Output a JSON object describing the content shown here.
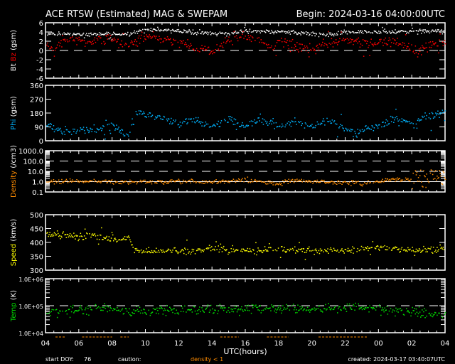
{
  "header": {
    "title": "ACE RTSW (Estimated) MAG & SWEPAM",
    "begin": "Begin: 2024-03-16 04:00:00UTC"
  },
  "footer": {
    "start_doy_label": "start DOY:",
    "start_doy": "76",
    "caution_label": "caution:",
    "caution_text": "density < 1",
    "created": "created: 2024-03-17 03:40:07UTC"
  },
  "colors": {
    "bt": "#ffffff",
    "bz": "#ff0000",
    "phi": "#00b4ff",
    "density": "#ff8c00",
    "speed": "#ffff00",
    "temp": "#00e000",
    "caution": "#ff8c00"
  },
  "chart_data": {
    "type": "scatter",
    "xlabel": "UTC(hours)",
    "x_range_hours": [
      0,
      24
    ],
    "x_tick_labels": [
      "04",
      "06",
      "08",
      "10",
      "12",
      "14",
      "16",
      "18",
      "20",
      "22",
      "00",
      "02",
      "04"
    ],
    "panels": [
      {
        "id": "mag",
        "ylabel_parts": [
          "Bt",
          "Bz",
          "(gsm)"
        ],
        "scale": "linear",
        "ylim": [
          -6,
          6
        ],
        "ticks": [
          6,
          4,
          2,
          0,
          -2,
          -4,
          -6
        ],
        "tick_labels": [
          "6",
          "4",
          "2",
          "0",
          "-2",
          "-4",
          "-6"
        ],
        "ref_lines": [
          0
        ],
        "series": [
          {
            "name": "Bt",
            "color": "bt",
            "trend": [
              [
                0,
                3.8
              ],
              [
                2,
                3.6
              ],
              [
                4,
                3.7
              ],
              [
                5,
                3.4
              ],
              [
                5.6,
                4.6
              ],
              [
                7,
                4.6
              ],
              [
                8,
                4.3
              ],
              [
                9,
                3.9
              ],
              [
                10,
                3.7
              ],
              [
                11,
                4.0
              ],
              [
                12,
                4.2
              ],
              [
                13,
                4.3
              ],
              [
                14,
                4.2
              ],
              [
                15,
                4.0
              ],
              [
                16,
                3.8
              ],
              [
                17,
                3.5
              ],
              [
                18,
                4.0
              ],
              [
                19,
                4.2
              ],
              [
                20,
                4.0
              ],
              [
                22,
                4.3
              ],
              [
                24,
                4.2
              ]
            ],
            "spread": 0.3
          },
          {
            "name": "Bz",
            "color": "bz",
            "trend": [
              [
                0,
                2.0
              ],
              [
                0.5,
                0.2
              ],
              [
                1,
                2.3
              ],
              [
                2,
                2.2
              ],
              [
                3,
                2.2
              ],
              [
                4,
                2.6
              ],
              [
                4.5,
                1.6
              ],
              [
                5,
                1.3
              ],
              [
                6,
                3.0
              ],
              [
                7,
                2.5
              ],
              [
                8,
                2.0
              ],
              [
                9,
                0.6
              ],
              [
                10,
                0.1
              ],
              [
                11,
                2.4
              ],
              [
                12,
                3.1
              ],
              [
                13,
                1.8
              ],
              [
                13.6,
                0.5
              ],
              [
                14,
                2.2
              ],
              [
                15,
                1.0
              ],
              [
                16,
                0.3
              ],
              [
                17,
                1.6
              ],
              [
                18,
                2.6
              ],
              [
                19,
                1.8
              ],
              [
                20,
                1.6
              ],
              [
                21,
                2.2
              ],
              [
                22,
                0.4
              ],
              [
                22.5,
                -0.4
              ],
              [
                23,
                1.2
              ],
              [
                24,
                2.0
              ]
            ],
            "spread": 0.7
          }
        ]
      },
      {
        "id": "phi",
        "ylabel_parts": [
          "Phi",
          "(gsm)"
        ],
        "scale": "linear",
        "ylim": [
          0,
          360
        ],
        "ticks": [
          360,
          270,
          180,
          90,
          0
        ],
        "tick_labels": [
          "360",
          "270",
          "180",
          "90",
          "0"
        ],
        "ref_lines": [],
        "series": [
          {
            "name": "Phi",
            "color": "phi",
            "trend": [
              [
                0,
                120
              ],
              [
                1,
                60
              ],
              [
                2,
                70
              ],
              [
                3,
                80
              ],
              [
                4,
                110
              ],
              [
                4.6,
                50
              ],
              [
                5,
                40
              ],
              [
                5.4,
                190
              ],
              [
                6,
                175
              ],
              [
                7,
                150
              ],
              [
                8,
                110
              ],
              [
                9,
                140
              ],
              [
                10,
                90
              ],
              [
                11,
                150
              ],
              [
                12,
                100
              ],
              [
                13,
                140
              ],
              [
                14,
                100
              ],
              [
                15,
                125
              ],
              [
                16,
                90
              ],
              [
                17,
                130
              ],
              [
                18,
                80
              ],
              [
                18.6,
                45
              ],
              [
                19,
                70
              ],
              [
                20,
                100
              ],
              [
                21,
                150
              ],
              [
                22,
                120
              ],
              [
                23,
                165
              ],
              [
                24,
                195
              ]
            ],
            "spread": 18
          }
        ]
      },
      {
        "id": "density",
        "ylabel_parts": [
          "Density",
          "(/cm3)"
        ],
        "scale": "log",
        "ylim": [
          0.1,
          1000
        ],
        "ticks": [
          1000,
          100,
          10,
          1,
          0.1
        ],
        "tick_labels": [
          "1000.0",
          "100.0",
          "10.0",
          "1.0",
          "0.1"
        ],
        "ref_lines": [
          100,
          10,
          1
        ],
        "series": [
          {
            "name": "Density",
            "color": "density",
            "trend": [
              [
                0,
                1.2
              ],
              [
                4,
                1.1
              ],
              [
                6,
                1.0
              ],
              [
                8,
                1.1
              ],
              [
                10,
                1.0
              ],
              [
                12,
                1.6
              ],
              [
                13,
                1.0
              ],
              [
                14,
                0.8
              ],
              [
                15,
                1.5
              ],
              [
                16,
                1.2
              ],
              [
                18,
                0.9
              ],
              [
                19,
                0.7
              ],
              [
                20,
                1.3
              ],
              [
                21,
                1.8
              ],
              [
                22,
                2.2
              ],
              [
                23,
                3
              ],
              [
                24,
                5
              ]
            ],
            "spread": 0.15
          }
        ]
      },
      {
        "id": "speed",
        "ylabel_parts": [
          "Speed",
          "(km/s)"
        ],
        "scale": "linear",
        "ylim": [
          300,
          500
        ],
        "ticks": [
          500,
          450,
          400,
          350,
          300
        ],
        "tick_labels": [
          "500",
          "450",
          "400",
          "350",
          "300"
        ],
        "ref_lines": [],
        "series": [
          {
            "name": "Speed",
            "color": "speed",
            "trend": [
              [
                0,
                430
              ],
              [
                2,
                425
              ],
              [
                3,
                430
              ],
              [
                4,
                410
              ],
              [
                5,
                415
              ],
              [
                5.3,
                370
              ],
              [
                8,
                372
              ],
              [
                10,
                378
              ],
              [
                12,
                372
              ],
              [
                14,
                378
              ],
              [
                16,
                372
              ],
              [
                18,
                374
              ],
              [
                20,
                385
              ],
              [
                22,
                372
              ],
              [
                24,
                380
              ]
            ],
            "spread": 8
          }
        ]
      },
      {
        "id": "temp",
        "ylabel_parts": [
          "Temp",
          "(K)"
        ],
        "scale": "log",
        "ylim": [
          10000,
          1000000
        ],
        "ticks": [
          1000000,
          100000,
          10000
        ],
        "tick_labels": [
          "1.0E+06",
          "1.0E+05",
          "1.0E+04"
        ],
        "ref_lines": [
          100000
        ],
        "series": [
          {
            "name": "Temp",
            "color": "temp",
            "trend": [
              [
                0,
                60000
              ],
              [
                2,
                65000
              ],
              [
                3,
                80000
              ],
              [
                4,
                75000
              ],
              [
                5,
                60000
              ],
              [
                6,
                65000
              ],
              [
                8,
                70000
              ],
              [
                10,
                75000
              ],
              [
                12,
                80000
              ],
              [
                14,
                85000
              ],
              [
                16,
                80000
              ],
              [
                18,
                90000
              ],
              [
                20,
                75000
              ],
              [
                22,
                60000
              ],
              [
                24,
                50000
              ]
            ],
            "spread": 0.12
          }
        ]
      }
    ]
  }
}
